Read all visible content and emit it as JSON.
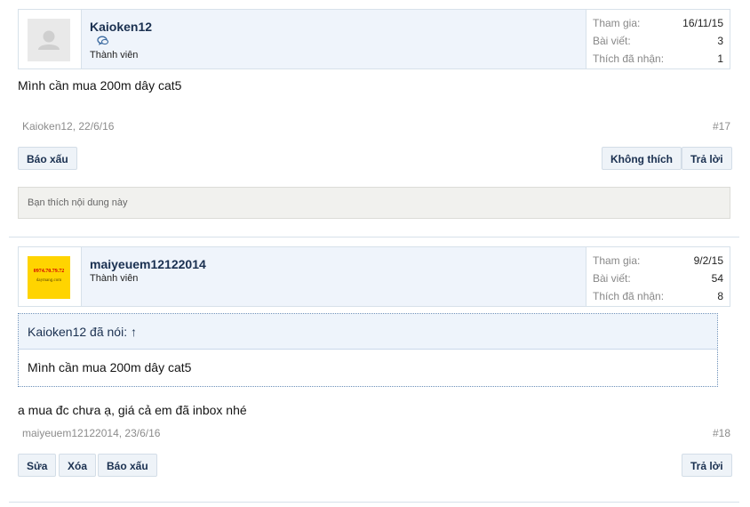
{
  "posts": [
    {
      "username": "Kaioken12",
      "user_title": "Thành viên",
      "stats": [
        {
          "label": "Tham gia:",
          "value": "16/11/15"
        },
        {
          "label": "Bài viết:",
          "value": "3"
        },
        {
          "label": "Thích đã nhận:",
          "value": "1"
        }
      ],
      "message": "Mình cần mua 200m dây cat5",
      "meta": "Kaioken12, 22/6/16",
      "number": "#17",
      "actions_left": [
        "Báo xấu"
      ],
      "actions_right": [
        "Không thích",
        "Trả lời"
      ],
      "likes_text": "Bạn thích nội dung này"
    },
    {
      "username": "maiyeuem12122014",
      "user_title": "Thành viên",
      "avatar_phone": "0974.70.79.72",
      "avatar_site": "daymang.com",
      "stats": [
        {
          "label": "Tham gia:",
          "value": "9/2/15"
        },
        {
          "label": "Bài viết:",
          "value": "54"
        },
        {
          "label": "Thích đã nhận:",
          "value": "8"
        }
      ],
      "quote_author": "Kaioken12 đã nói: ↑",
      "quote_text": "Mình cần mua 200m dây cat5",
      "message": "a mua đc chưa ạ, giá cả em đã inbox nhé",
      "meta": "maiyeuem12122014, 23/6/16",
      "number": "#18",
      "actions_left": [
        "Sửa",
        "Xóa",
        "Báo xấu"
      ],
      "actions_right": [
        "Trả lời"
      ]
    }
  ],
  "icons": {
    "avatar_default": "user-silhouette-icon",
    "chat": "chat-bubble-icon",
    "quote_jump": "arrow-up-icon"
  },
  "colors": {
    "username": "#1a3050",
    "userbar_bg": "#eff4fb",
    "muted": "#8c8c8c",
    "likes_bg": "#f1f1ee"
  }
}
